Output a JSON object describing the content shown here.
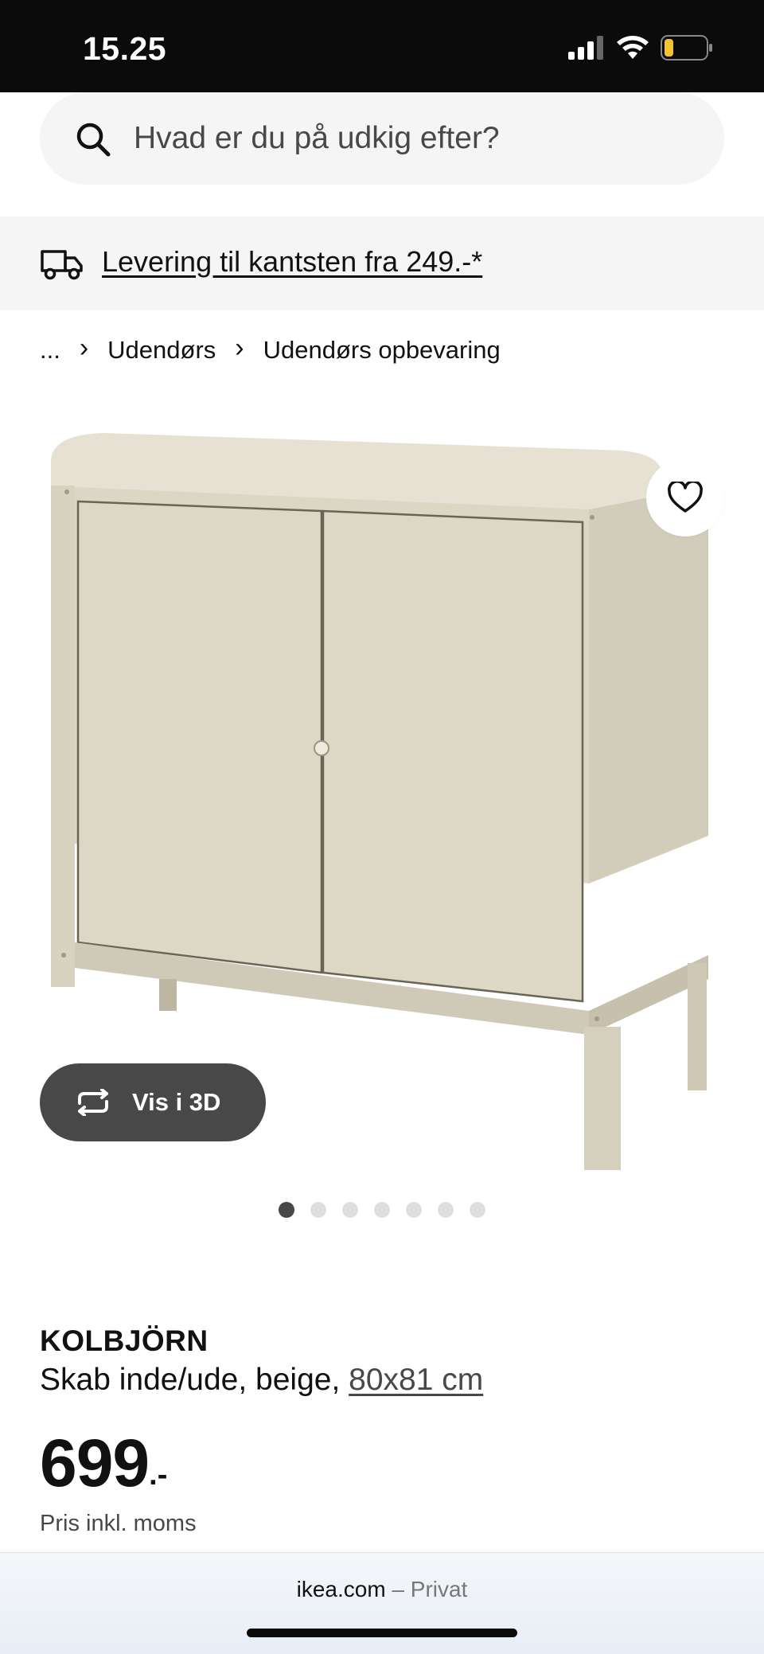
{
  "status_bar": {
    "time": "15.25",
    "battery_color": "#f4c430"
  },
  "search": {
    "placeholder": "Hvad er du på udkig efter?",
    "icon": "search-icon"
  },
  "delivery": {
    "text": "Levering til kantsten fra 249.-*",
    "icon": "truck-icon"
  },
  "breadcrumb": {
    "items": [
      "...",
      "Udendørs",
      "Udendørs opbevaring"
    ]
  },
  "gallery": {
    "view_3d_label": "Vis i 3D",
    "image_count": 7,
    "active_index": 0
  },
  "product": {
    "name": "KOLBJÖRN",
    "description": "Skab inde/ude, beige, ",
    "size": "80x81 cm",
    "price_integer": "699",
    "price_suffix": ".-",
    "price_note": "Pris inkl. moms"
  },
  "browser": {
    "domain": "ikea.com",
    "separator": " – ",
    "mode": "Privat"
  },
  "colors": {
    "accent_dark": "#484848",
    "cabinet": "#ddd7c6",
    "background_light": "#f5f5f5"
  }
}
